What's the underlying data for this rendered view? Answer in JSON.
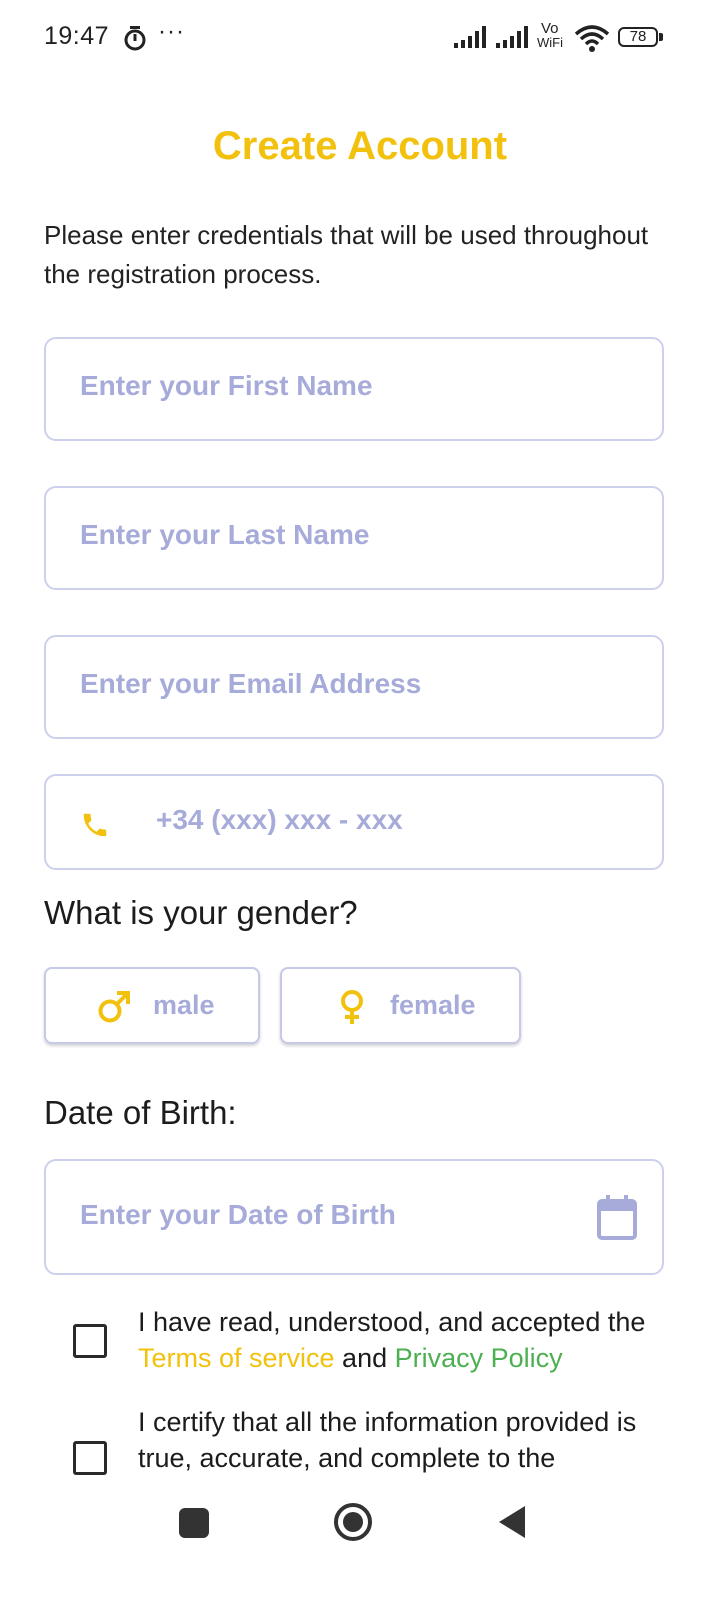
{
  "status_bar": {
    "time": "19:47",
    "more": "···",
    "vowifi_top": "Vo",
    "vowifi_bottom": "WiFi",
    "battery": "78"
  },
  "title": "Create Account",
  "subtitle": "Please enter credentials that will be used throughout the registration process.",
  "fields": {
    "first_name_placeholder": "Enter your First Name",
    "last_name_placeholder": "Enter your Last Name",
    "email_placeholder": "Enter your Email Address",
    "phone_placeholder": "+34 (xxx) xxx - xxx",
    "dob_placeholder": "Enter your Date of Birth"
  },
  "gender": {
    "question": "What is your gender?",
    "male_label": "male",
    "female_label": "female"
  },
  "dob_label": "Date of Birth:",
  "consents": {
    "terms_prefix": "I have read, understood, and accepted the ",
    "terms_link": "Terms of service",
    "terms_and": " and ",
    "privacy_link": "Privacy Policy",
    "certify_text": "I certify that all the information provided is true, accurate, and complete to the"
  },
  "colors": {
    "accent": "#f2c10d",
    "placeholder": "#a6abd9",
    "border": "#cdd0ec",
    "privacy_link": "#4caf50"
  },
  "icons": {
    "phone": "phone-icon",
    "male": "male-icon",
    "female": "female-icon",
    "calendar": "calendar-icon"
  }
}
